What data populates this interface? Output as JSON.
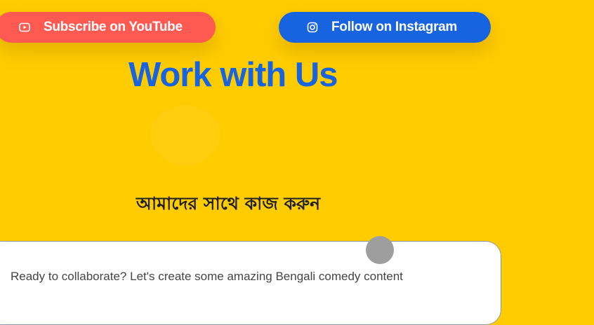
{
  "buttons": {
    "youtube": {
      "label": "Subscribe on YouTube",
      "icon": "youtube-icon",
      "color": "#ff5a52"
    },
    "instagram": {
      "label": "Follow on Instagram",
      "icon": "instagram-icon",
      "color": "#1763e0"
    }
  },
  "heading": {
    "title": "Work with Us",
    "subtitle": "আমাদের সাথে কাজ করুন"
  },
  "card": {
    "text": "Ready to collaborate? Let's create some amazing Bengali comedy content"
  },
  "colors": {
    "background": "#ffcc00",
    "title": "#1763e0"
  }
}
